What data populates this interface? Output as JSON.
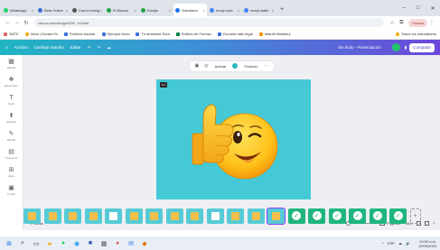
{
  "browser": {
    "tabs": [
      {
        "label": "WhatsApp",
        "color": "#25d366"
      },
      {
        "label": "Beta Online",
        "color": "#3b6fd8"
      },
      {
        "label": "Canva Design",
        "color": "#555555"
      },
      {
        "label": "El Mundo",
        "color": "#25a244"
      },
      {
        "label": "Emojis",
        "color": "#25a244"
      },
      {
        "label": "Voluntario",
        "color": "#1a73e8"
      },
      {
        "label": "emoji cara",
        "color": "#4285f4"
      },
      {
        "label": "emoji maikr",
        "color": "#4285f4"
      }
    ],
    "new_tab": "+",
    "window_controls": {
      "minimize": "–",
      "maximize": "□",
      "close": "✕"
    },
    "address": "canva.com/design/DAF...h0/edit",
    "profile_label": "Pausar"
  },
  "bookmarks": [
    {
      "label": "SNTE",
      "color": "#e06666"
    },
    {
      "label": "Inicio | Dream Ex",
      "color": "#f0b429"
    },
    {
      "label": "Eventos escolar",
      "color": "#3b6fd8"
    },
    {
      "label": "Ejemplo Inicio",
      "color": "#3b6fd8"
    },
    {
      "label": "Tu ambiente Edut",
      "color": "#3b6fd8"
    },
    {
      "label": "Edificio de Formac",
      "color": "#0b8043"
    },
    {
      "label": "Escuela dato legal",
      "color": "#3b6fd8"
    },
    {
      "label": "Infantil Ministery",
      "color": "#f09300"
    }
  ],
  "bookmarks_all": "Todos los marcadores",
  "canva": {
    "menu": [
      "Archivo",
      "Cambiar tamaño",
      "Editar",
      "↶",
      "↷",
      "☁"
    ],
    "title": "Sin título - Presentación",
    "share": "Compartir"
  },
  "sidebar": [
    {
      "icon": "▦",
      "label": "Diseño"
    },
    {
      "icon": "❖",
      "label": "Elementos"
    },
    {
      "icon": "T",
      "label": "Texto"
    },
    {
      "icon": "⬆",
      "label": "Subidos"
    },
    {
      "icon": "✎",
      "label": "Dibujar"
    },
    {
      "icon": "▤",
      "label": "Proyectos"
    },
    {
      "icon": "⊞",
      "label": "Apps"
    },
    {
      "icon": "▣",
      "label": "Fondo"
    }
  ],
  "context_bar": {
    "animate": "Animar",
    "position": "Posición",
    "color_hex": "#2bb3c0"
  },
  "page_badge": "P.1",
  "bottom": {
    "notes": "Notas",
    "pages": "Páginas",
    "zoom": "34%",
    "zoom_fraction": 0.38
  },
  "thumbnails": [
    {
      "style": "cyan",
      "inner": "yellow"
    },
    {
      "style": "cyan",
      "inner": "yellow"
    },
    {
      "style": "cyan",
      "inner": "yellow"
    },
    {
      "style": "cyan",
      "inner": "yellow"
    },
    {
      "style": "cyan",
      "inner": "white"
    },
    {
      "style": "cyan",
      "inner": "yellow"
    },
    {
      "style": "cyan",
      "inner": "yellow"
    },
    {
      "style": "cyan",
      "inner": "yellow"
    },
    {
      "style": "cyan",
      "inner": "yellow"
    },
    {
      "style": "cyan",
      "inner": "white"
    },
    {
      "style": "cyan",
      "inner": "yellow"
    },
    {
      "style": "cyan",
      "inner": "yellow"
    },
    {
      "style": "cyan",
      "inner": "yellow",
      "selected": true
    },
    {
      "style": "green"
    },
    {
      "style": "green"
    },
    {
      "style": "green"
    },
    {
      "style": "green"
    },
    {
      "style": "green"
    },
    {
      "style": "green"
    }
  ],
  "taskbar": {
    "tray": [
      "^",
      "ESP",
      "☁",
      "🔊"
    ],
    "time": "10:53 a.m.",
    "date": "12/09/2023"
  }
}
